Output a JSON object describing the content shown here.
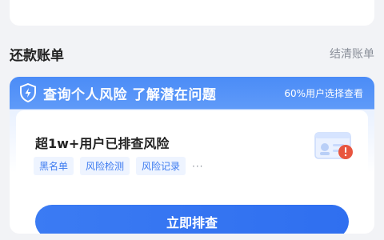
{
  "section": {
    "title": "还款账单",
    "link": "结清账单"
  },
  "risk_card": {
    "banner_title": "查询个人风险 了解潜在问题",
    "banner_hint": "60%用户选择查看",
    "headline": "超1w+用户已排查风险",
    "tags": [
      "黑名单",
      "风险检测",
      "风险记录"
    ],
    "more": "···",
    "cta_label": "立即排查"
  },
  "colors": {
    "accent": "#3b7bf3",
    "banner": "#4b8cf7",
    "alert": "#e8553f"
  },
  "icons": {
    "banner": "shield-lightning-icon",
    "illustration": "id-card-alert-icon"
  }
}
